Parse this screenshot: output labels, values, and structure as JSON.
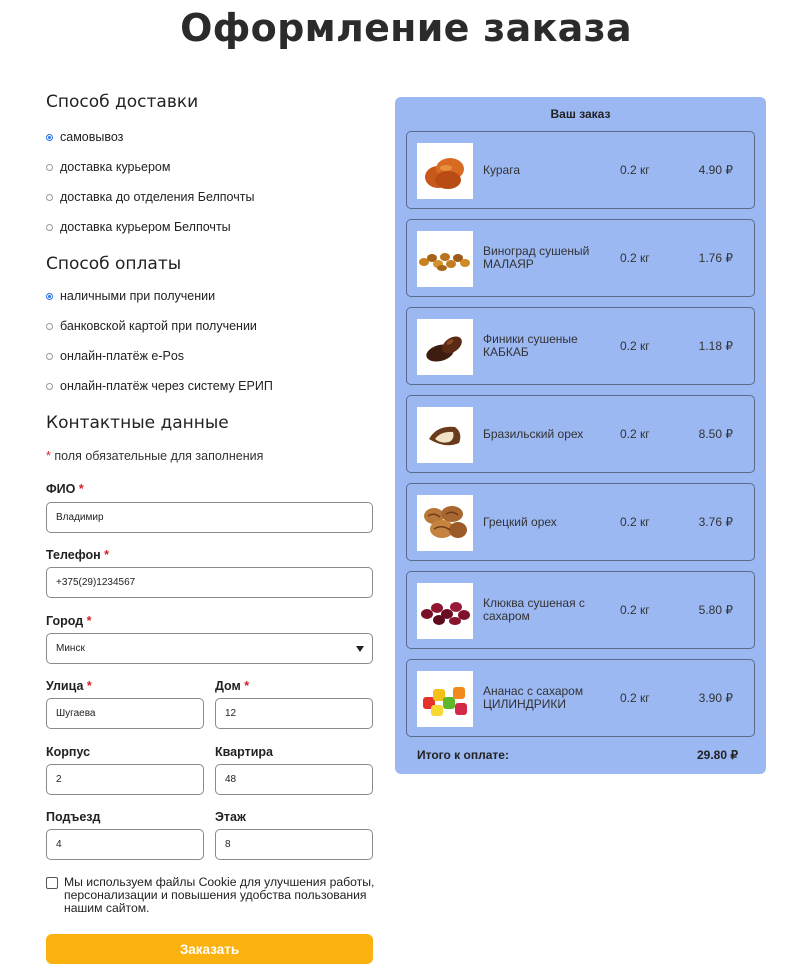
{
  "page_title": "Оформление заказа",
  "delivery": {
    "title": "Способ доставки",
    "options": [
      {
        "label": "самовывоз",
        "checked": true
      },
      {
        "label": "доставка курьером",
        "checked": false
      },
      {
        "label": "доставка до отделения Белпочты",
        "checked": false
      },
      {
        "label": "доставка курьером Белпочты",
        "checked": false
      }
    ]
  },
  "payment": {
    "title": "Способ оплаты",
    "options": [
      {
        "label": "наличными при получении",
        "checked": true
      },
      {
        "label": "банковской картой при получении",
        "checked": false
      },
      {
        "label": "онлайн-платёж e-Pos",
        "checked": false
      },
      {
        "label": "онлайн-платёж через систему ЕРИП",
        "checked": false
      }
    ]
  },
  "contacts": {
    "title": "Контактные данные",
    "required_star": "*",
    "required_note": "поля обязательные для заполнения",
    "fio_label": "ФИО",
    "fio_value": "Владимир",
    "phone_label": "Телефон",
    "phone_value": "+375(29)1234567",
    "city_label": "Город",
    "city_value": "Минск",
    "street_label": "Улица",
    "street_value": "Шугаева",
    "house_label": "Дом",
    "house_value": "12",
    "building_label": "Корпус",
    "building_value": "2",
    "apartment_label": "Квартира",
    "apartment_value": "48",
    "entrance_label": "Подъезд",
    "entrance_value": "4",
    "floor_label": "Этаж",
    "floor_value": "8"
  },
  "cookie_text": "Мы используем файлы Cookie для улучшения работы, персонализации и повышения удобства пользования нашим сайтом.",
  "submit_label": "Заказать",
  "order": {
    "title": "Ваш заказ",
    "items": [
      {
        "name": "Курага",
        "weight": "0.2 кг",
        "price": "4.90 ₽",
        "icon": "dried-apricot-image"
      },
      {
        "name": "Виноград сушеный МАЛАЯР",
        "weight": "0.2 кг",
        "price": "1.76 ₽",
        "icon": "raisins-image"
      },
      {
        "name": "Финики сушеные КАБКАБ",
        "weight": "0.2 кг",
        "price": "1.18 ₽",
        "icon": "dates-image"
      },
      {
        "name": "Бразильский орех",
        "weight": "0.2 кг",
        "price": "8.50 ₽",
        "icon": "brazil-nut-image"
      },
      {
        "name": "Грецкий орех",
        "weight": "0.2 кг",
        "price": "3.76 ₽",
        "icon": "walnut-image"
      },
      {
        "name": "Клюква сушеная с сахаром",
        "weight": "0.2 кг",
        "price": "5.80 ₽",
        "icon": "cranberries-image"
      },
      {
        "name": "Ананас с сахаром ЦИЛИНДРИКИ",
        "weight": "0.2 кг",
        "price": "3.90 ₽",
        "icon": "candied-pineapple-image"
      }
    ],
    "total_label": "Итого к оплате:",
    "total_value": "29.80 ₽"
  },
  "colors": {
    "accent_button": "#fbb10e",
    "order_panel": "#9bb8f3",
    "radio_checked": "#2a74e8",
    "required_star": "#d4202a"
  }
}
